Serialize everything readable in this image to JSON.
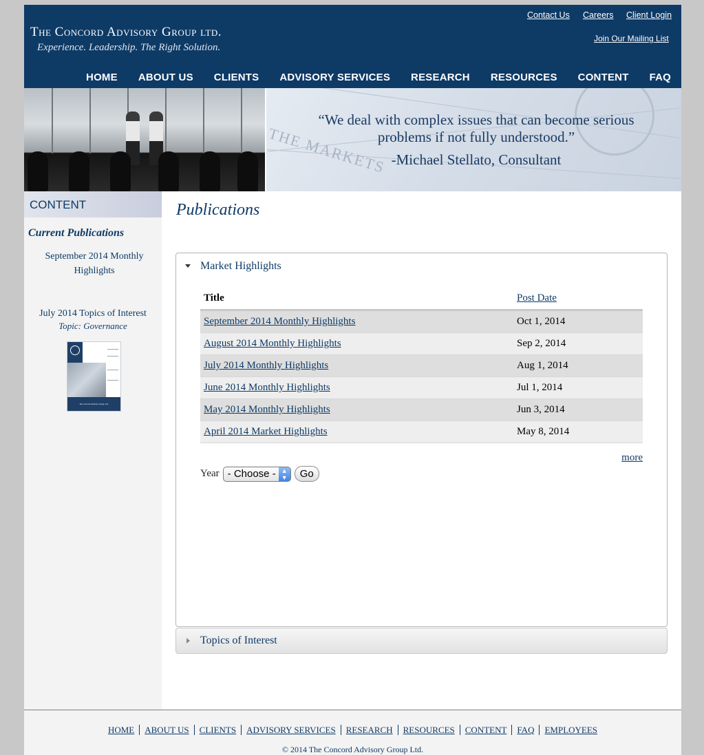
{
  "header": {
    "logo_name": "The Concord Advisory Group ltd.",
    "tagline": "Experience. Leadership. The Right Solution.",
    "top_links": [
      "Contact Us",
      "Careers",
      "Client Login"
    ],
    "mailing_list": "Join Our Mailing List",
    "nav": [
      "HOME",
      "ABOUT US",
      "CLIENTS",
      "ADVISORY SERVICES",
      "RESEARCH",
      "RESOURCES",
      "CONTENT",
      "FAQ"
    ]
  },
  "banner": {
    "quote": "“We deal with complex issues that can become serious problems if not fully understood.”",
    "author": "-Michael Stellato, Consultant",
    "background_word": "THE MARKETS"
  },
  "sidebar": {
    "title": "CONTENT",
    "current_label": "Current Publications",
    "link1": "September 2014 Monthly Highlights",
    "link2": "July 2014 Topics of Interest",
    "link2_topic": "Topic: Governance",
    "cover_footer": "The Concord Advisory Group, Ltd."
  },
  "main": {
    "title": "Publications",
    "accordion1": "Market Highlights",
    "accordion2": "Topics of Interest",
    "table": {
      "col_title": "Title",
      "col_date": "Post Date",
      "rows": [
        {
          "title": "September 2014 Monthly Highlights",
          "date": "Oct 1, 2014"
        },
        {
          "title": "August 2014 Monthly Highlights",
          "date": "Sep 2, 2014"
        },
        {
          "title": "July 2014 Monthly Highlights",
          "date": "Aug 1, 2014"
        },
        {
          "title": "June 2014 Monthly Highlights",
          "date": "Jul 1, 2014"
        },
        {
          "title": "May 2014 Monthly Highlights",
          "date": "Jun 3, 2014"
        },
        {
          "title": "April 2014 Market Highlights",
          "date": "May 8, 2014"
        }
      ]
    },
    "more": "more",
    "year_label": "Year",
    "year_select": "- Choose -",
    "go": "Go"
  },
  "footer": {
    "nav": [
      "HOME",
      "ABOUT US",
      "CLIENTS",
      "ADVISORY SERVICES",
      "RESEARCH",
      "RESOURCES",
      "CONTENT",
      "FAQ",
      "EMPLOYEES"
    ],
    "copyright": "© 2014 The Concord Advisory Group Ltd."
  },
  "colors": {
    "brand_navy": "#0e3a66",
    "page_bg": "#c8c8c8",
    "sidebar_bg": "#f3f3f3"
  }
}
